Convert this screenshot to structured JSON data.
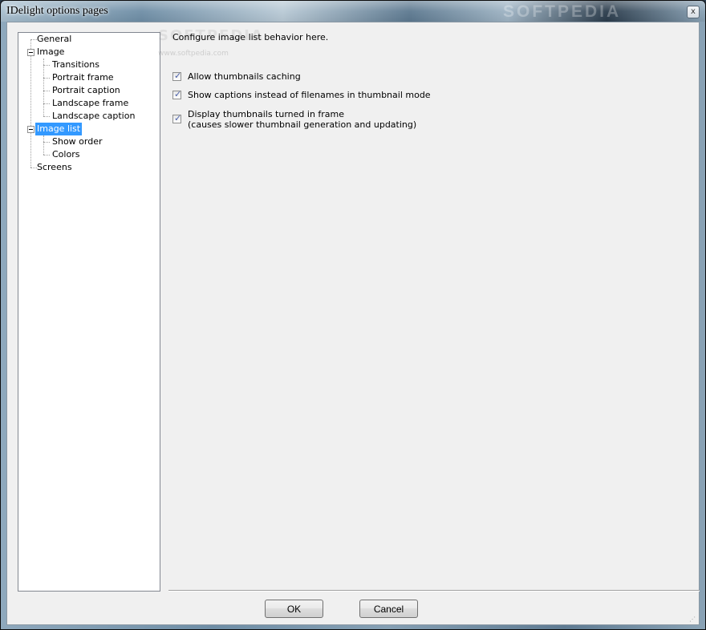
{
  "window": {
    "title": "IDelight options pages",
    "close_glyph": "x",
    "watermark": "SOFTPEDIA"
  },
  "tree": {
    "items": [
      {
        "label": "General",
        "level": 0,
        "selected": false
      },
      {
        "label": "Image",
        "level": 0,
        "selected": false,
        "expanded": true
      },
      {
        "label": "Transitions",
        "level": 1,
        "selected": false
      },
      {
        "label": "Portrait frame",
        "level": 1,
        "selected": false
      },
      {
        "label": "Portrait caption",
        "level": 1,
        "selected": false
      },
      {
        "label": "Landscape frame",
        "level": 1,
        "selected": false
      },
      {
        "label": "Landscape caption",
        "level": 1,
        "selected": false
      },
      {
        "label": "Image list",
        "level": 0,
        "selected": true,
        "expanded": true
      },
      {
        "label": "Show order",
        "level": 1,
        "selected": false
      },
      {
        "label": "Colors",
        "level": 1,
        "selected": false
      },
      {
        "label": "Screens",
        "level": 0,
        "selected": false
      }
    ]
  },
  "page": {
    "description": "Configure image list behavior here.",
    "watermark_small": "SOFTPEDIA",
    "watermark_url": "www.softpedia.com",
    "options": [
      {
        "label": "Allow thumbnails caching",
        "checked": true
      },
      {
        "label": "Show captions instead of filenames in thumbnail mode",
        "checked": true
      },
      {
        "label": "Display thumbnails turned in frame",
        "label2": "(causes slower thumbnail generation and updating)",
        "checked": true
      }
    ]
  },
  "buttons": {
    "ok_label": "OK",
    "cancel_label": "Cancel"
  },
  "colors": {
    "selection": "#3399ff",
    "dialog_bg": "#f0f0f0"
  }
}
